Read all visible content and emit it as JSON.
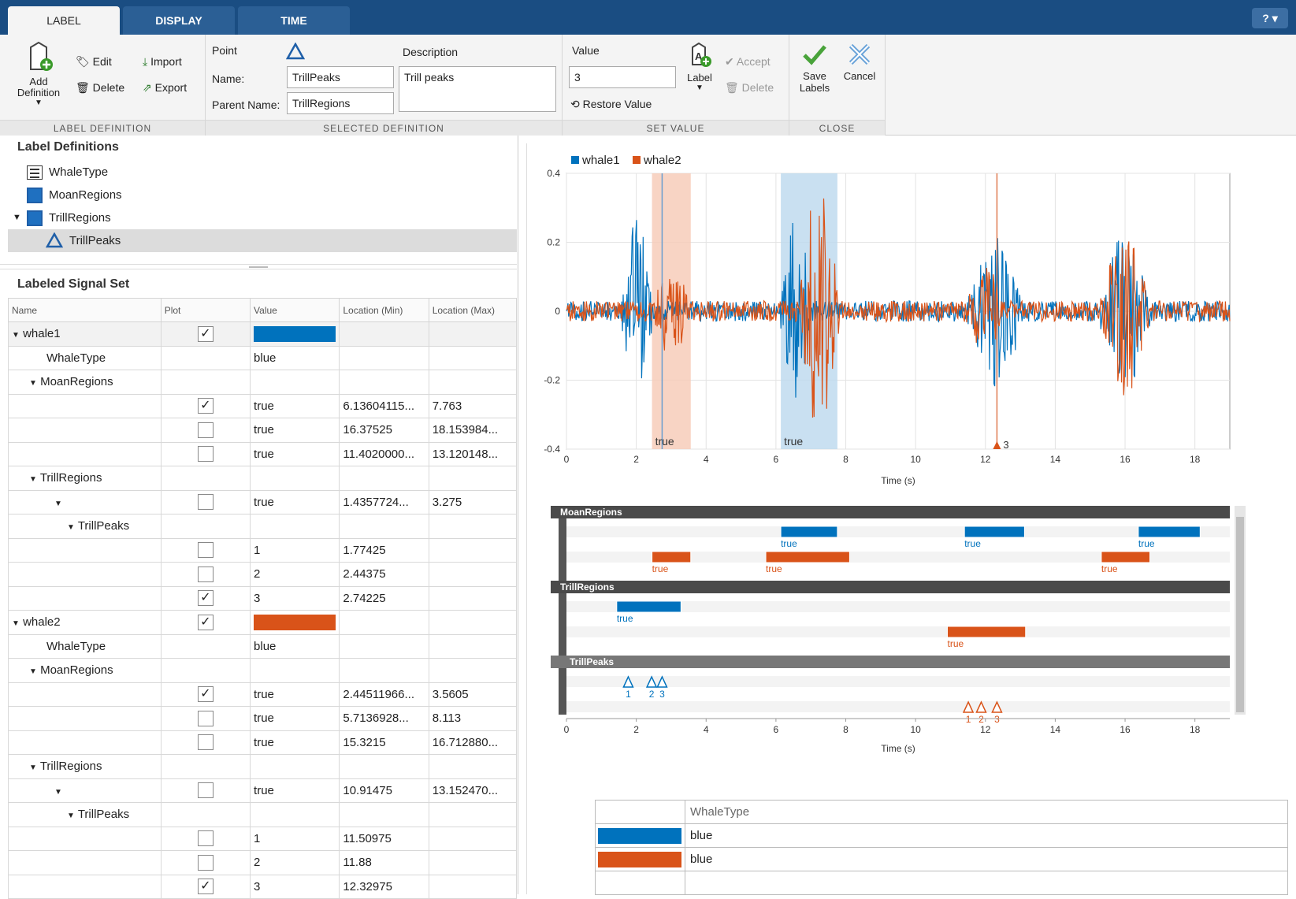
{
  "tabs": [
    {
      "label": "LABEL"
    },
    {
      "label": "DISPLAY"
    },
    {
      "label": "TIME"
    }
  ],
  "help": "?",
  "ribbon": {
    "label_definition": {
      "title": "LABEL DEFINITION",
      "add": "Add Definition",
      "edit": "Edit",
      "delete": "Delete",
      "import": "Import",
      "export": "Export"
    },
    "selected_definition": {
      "title": "SELECTED DEFINITION",
      "type": "Point",
      "name_label": "Name:",
      "name_value": "TrillPeaks",
      "parent_label": "Parent Name:",
      "parent_value": "TrillRegions",
      "desc_label": "Description",
      "desc_value": "Trill peaks"
    },
    "set_value": {
      "title": "SET VALUE",
      "value_label": "Value",
      "value": "3",
      "restore": "Restore Value",
      "label_btn": "Label",
      "accept": "Accept",
      "delete": "Delete"
    },
    "close": {
      "title": "CLOSE",
      "save": "Save Labels",
      "cancel": "Cancel"
    }
  },
  "label_definitions": {
    "title": "Label Definitions",
    "items": [
      {
        "label": "WhaleType"
      },
      {
        "label": "MoanRegions"
      },
      {
        "label": "TrillRegions"
      },
      {
        "label": "TrillPeaks"
      }
    ]
  },
  "signal_set": {
    "title": "Labeled Signal Set",
    "columns": [
      "Name",
      "Plot",
      "Value",
      "Location (Min)",
      "Location (Max)"
    ],
    "rows": [
      {
        "name": "whale1",
        "indent": 0,
        "caret": true,
        "checked": true,
        "value": "",
        "min": "",
        "max": "",
        "swatch": "#0072bd",
        "grp": true
      },
      {
        "name": "WhaleType",
        "indent": 2,
        "caret": false,
        "checked": null,
        "value": "blue",
        "min": "",
        "max": ""
      },
      {
        "name": "MoanRegions",
        "indent": 1,
        "caret": true,
        "checked": null,
        "value": "",
        "min": "",
        "max": ""
      },
      {
        "name": "",
        "indent": 0,
        "caret": false,
        "checked": true,
        "value": "true",
        "min": "6.13604115...",
        "max": "7.763"
      },
      {
        "name": "",
        "indent": 0,
        "caret": false,
        "checked": false,
        "value": "true",
        "min": "16.37525",
        "max": "18.153984..."
      },
      {
        "name": "",
        "indent": 0,
        "caret": false,
        "checked": false,
        "value": "true",
        "min": "11.4020000...",
        "max": "13.120148..."
      },
      {
        "name": "TrillRegions",
        "indent": 1,
        "caret": true,
        "checked": null,
        "value": "",
        "min": "",
        "max": ""
      },
      {
        "name": "",
        "indent": 3,
        "caret": true,
        "checked": false,
        "value": "true",
        "min": "1.4357724...",
        "max": "3.275"
      },
      {
        "name": "TrillPeaks",
        "indent": 4,
        "caret": true,
        "checked": null,
        "value": "",
        "min": "",
        "max": ""
      },
      {
        "name": "",
        "indent": 0,
        "caret": false,
        "checked": false,
        "value": "1",
        "min": "1.77425",
        "max": ""
      },
      {
        "name": "",
        "indent": 0,
        "caret": false,
        "checked": false,
        "value": "2",
        "min": "2.44375",
        "max": ""
      },
      {
        "name": "",
        "indent": 0,
        "caret": false,
        "checked": true,
        "value": "3",
        "min": "2.74225",
        "max": ""
      },
      {
        "name": "whale2",
        "indent": 0,
        "caret": true,
        "checked": true,
        "value": "",
        "min": "",
        "max": "",
        "swatch": "#d95319"
      },
      {
        "name": "WhaleType",
        "indent": 2,
        "caret": false,
        "checked": null,
        "value": "blue",
        "min": "",
        "max": ""
      },
      {
        "name": "MoanRegions",
        "indent": 1,
        "caret": true,
        "checked": null,
        "value": "",
        "min": "",
        "max": ""
      },
      {
        "name": "",
        "indent": 0,
        "caret": false,
        "checked": true,
        "value": "true",
        "min": "2.44511966...",
        "max": "3.5605"
      },
      {
        "name": "",
        "indent": 0,
        "caret": false,
        "checked": false,
        "value": "true",
        "min": "5.7136928...",
        "max": "8.113"
      },
      {
        "name": "",
        "indent": 0,
        "caret": false,
        "checked": false,
        "value": "true",
        "min": "15.3215",
        "max": "16.712880..."
      },
      {
        "name": "TrillRegions",
        "indent": 1,
        "caret": true,
        "checked": null,
        "value": "",
        "min": "",
        "max": ""
      },
      {
        "name": "",
        "indent": 3,
        "caret": true,
        "checked": false,
        "value": "true",
        "min": "10.91475",
        "max": "13.152470..."
      },
      {
        "name": "TrillPeaks",
        "indent": 4,
        "caret": true,
        "checked": null,
        "value": "",
        "min": "",
        "max": ""
      },
      {
        "name": "",
        "indent": 0,
        "caret": false,
        "checked": false,
        "value": "1",
        "min": "11.50975",
        "max": ""
      },
      {
        "name": "",
        "indent": 0,
        "caret": false,
        "checked": false,
        "value": "2",
        "min": "11.88",
        "max": ""
      },
      {
        "name": "",
        "indent": 0,
        "caret": false,
        "checked": true,
        "value": "3",
        "min": "12.32975",
        "max": ""
      }
    ]
  },
  "colors": {
    "whale1": "#0072bd",
    "whale2": "#d95319"
  },
  "chart_data": [
    {
      "type": "line",
      "series": [
        {
          "name": "whale1"
        },
        {
          "name": "whale2"
        }
      ],
      "xlabel": "Time (s)",
      "xlim": [
        0,
        19
      ],
      "ylim": [
        -0.4,
        0.4
      ],
      "xticks": [
        0,
        2,
        4,
        6,
        8,
        10,
        12,
        14,
        16,
        18
      ],
      "yticks": [
        -0.4,
        -0.2,
        0,
        0.2,
        0.4
      ],
      "region_labels": [
        {
          "x": [
            2.45,
            3.56
          ],
          "text": "true"
        },
        {
          "x": [
            6.14,
            7.76
          ],
          "text": "true"
        }
      ],
      "point_marker": {
        "x": 12.33,
        "text": "3"
      },
      "bursts": [
        {
          "series": "whale1",
          "x": [
            1.6,
            2.45
          ],
          "amp": 0.27
        },
        {
          "series": "whale2",
          "x": [
            2.45,
            3.56
          ],
          "amp": 0.13
        },
        {
          "series": "whale1",
          "x": [
            6.14,
            7.0
          ],
          "amp": 0.28
        },
        {
          "series": "whale2",
          "x": [
            6.7,
            7.8
          ],
          "amp": 0.38
        },
        {
          "series": "whale1",
          "x": [
            11.5,
            13.1
          ],
          "amp": 0.22
        },
        {
          "series": "whale2",
          "x": [
            11.4,
            12.6
          ],
          "amp": 0.13
        },
        {
          "series": "whale1",
          "x": [
            15.3,
            16.7
          ],
          "amp": 0.23
        },
        {
          "series": "whale2",
          "x": [
            15.3,
            16.7
          ],
          "amp": 0.26
        }
      ]
    },
    {
      "type": "bar",
      "xlabel": "Time (s)",
      "xlim": [
        0,
        19
      ],
      "xticks": [
        0,
        2,
        4,
        6,
        8,
        10,
        12,
        14,
        16,
        18
      ],
      "groups": [
        "MoanRegions",
        "TrillRegions",
        "TrillPeaks"
      ],
      "regions": [
        {
          "group": "MoanRegions",
          "series": "whale1",
          "x": [
            6.14,
            7.76
          ],
          "text": "true"
        },
        {
          "group": "MoanRegions",
          "series": "whale1",
          "x": [
            11.4,
            13.12
          ],
          "text": "true"
        },
        {
          "group": "MoanRegions",
          "series": "whale1",
          "x": [
            16.38,
            18.15
          ],
          "text": "true"
        },
        {
          "group": "MoanRegions",
          "series": "whale2",
          "x": [
            2.45,
            3.56
          ],
          "text": "true"
        },
        {
          "group": "MoanRegions",
          "series": "whale2",
          "x": [
            5.71,
            8.11
          ],
          "text": "true"
        },
        {
          "group": "MoanRegions",
          "series": "whale2",
          "x": [
            15.32,
            16.71
          ],
          "text": "true"
        },
        {
          "group": "TrillRegions",
          "series": "whale1",
          "x": [
            1.44,
            3.28
          ],
          "text": "true"
        },
        {
          "group": "TrillRegions",
          "series": "whale2",
          "x": [
            10.91,
            13.15
          ],
          "text": "true"
        }
      ],
      "points": [
        {
          "series": "whale1",
          "x": 1.77,
          "text": "1"
        },
        {
          "series": "whale1",
          "x": 2.44,
          "text": "2"
        },
        {
          "series": "whale1",
          "x": 2.74,
          "text": "3"
        },
        {
          "series": "whale2",
          "x": 11.51,
          "text": "1"
        },
        {
          "series": "whale2",
          "x": 11.88,
          "text": "2"
        },
        {
          "series": "whale2",
          "x": 12.33,
          "text": "3"
        }
      ]
    }
  ],
  "whale_type_table": {
    "header": "WhaleType",
    "rows": [
      {
        "color": "#0072bd",
        "value": "blue"
      },
      {
        "color": "#d95319",
        "value": "blue"
      }
    ]
  }
}
